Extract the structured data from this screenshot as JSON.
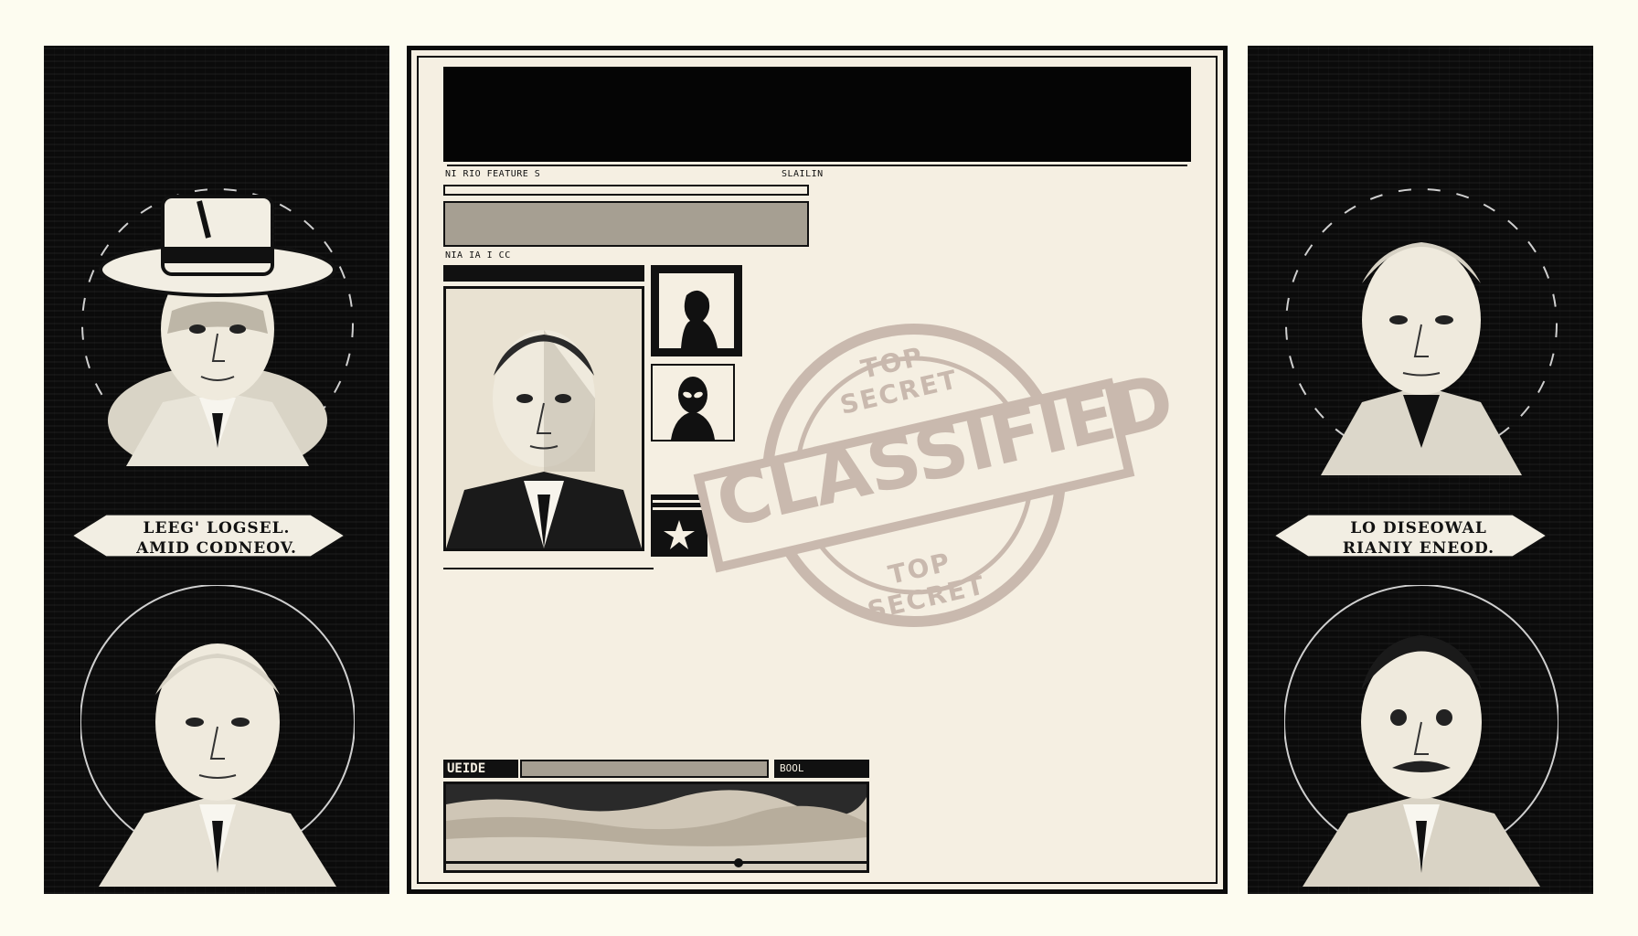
{
  "left_panel": {
    "banner_line1": "LEEG' LOGSEL.",
    "banner_line2": "AMID CODNEOV."
  },
  "right_panel": {
    "banner_line1": "LO DISEOWAL",
    "banner_line2": "RIANIY ENEOD."
  },
  "document": {
    "header_label_left": "NI RIO FEATURE S",
    "header_label_right": "SLAILIN",
    "section_label": "NIA  IA I CC",
    "stamp": {
      "top_text": "TOP SECRET",
      "main_text": "CLASSIFIED",
      "bottom_text": "TOP SECRET"
    },
    "footer_tab_left": "UEIDE",
    "footer_tab_right": "BOOL"
  },
  "colors": {
    "ink": "#0b0b0b",
    "paper": "#f5efe2",
    "stamp": "#c9b9ae",
    "gray_bar": "#a69f92"
  }
}
